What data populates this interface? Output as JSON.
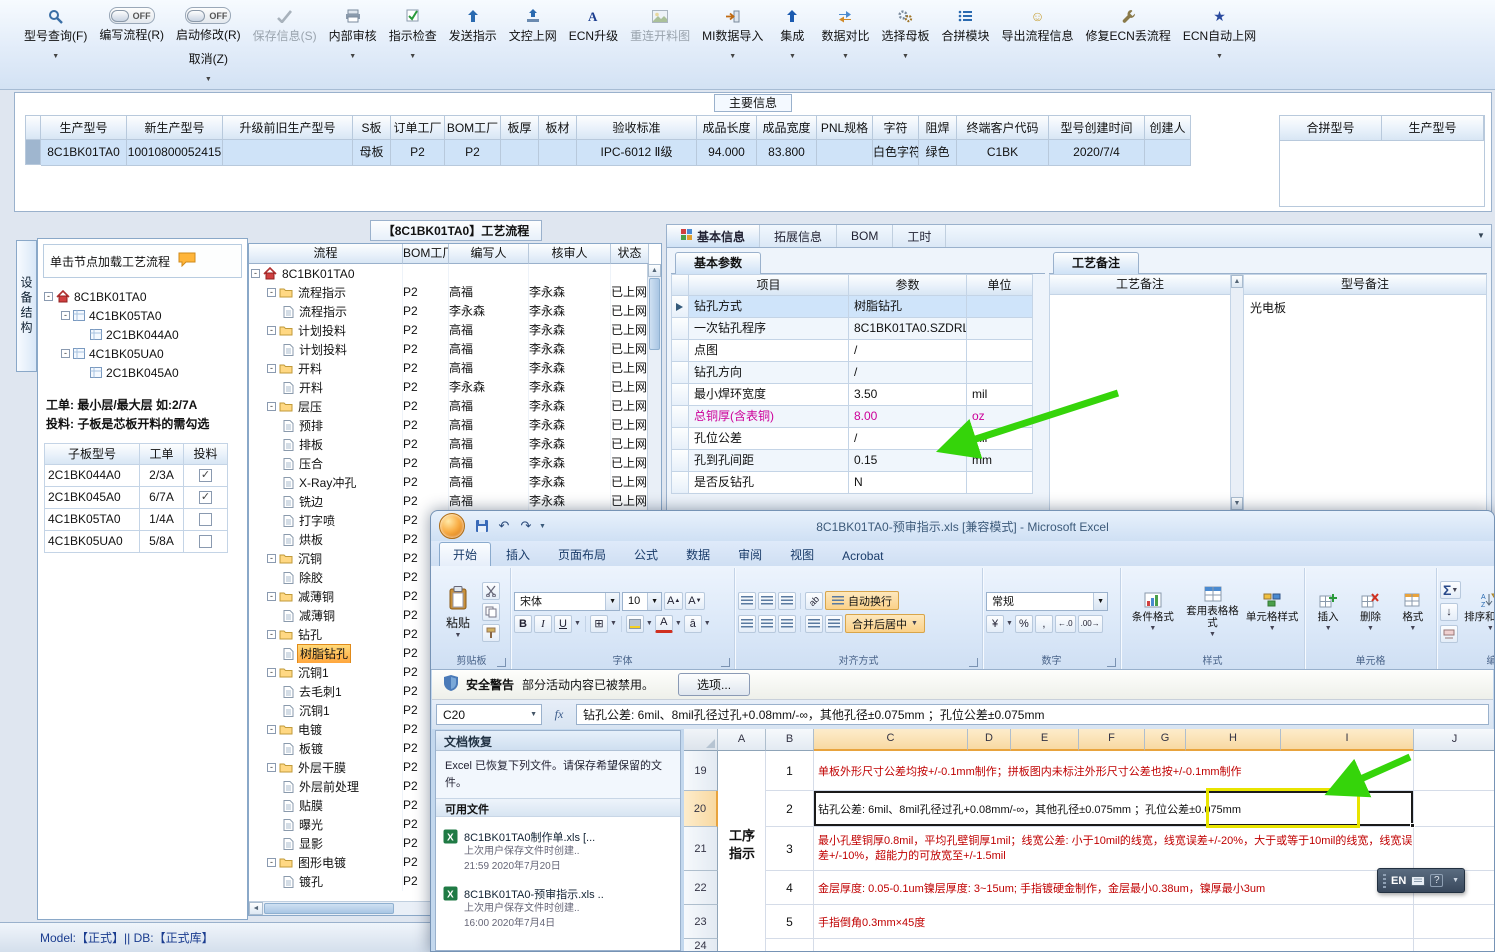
{
  "toolbar": {
    "items": [
      {
        "label": "型号查询(F)",
        "icon": "search",
        "caret": true
      },
      {
        "label": "编写流程(R)",
        "toggle": "OFF"
      },
      {
        "label": "启动修改(R)",
        "toggle": "OFF",
        "sub": "取消(Z)",
        "caret": true
      },
      {
        "label": "保存信息(S)",
        "icon": "save",
        "disabled": true
      },
      {
        "label": "内部审核",
        "icon": "printer",
        "caret": true
      },
      {
        "label": "指示检查",
        "icon": "checkbox",
        "caret": true
      },
      {
        "label": "发送指示",
        "icon": "send"
      },
      {
        "label": "文控上网",
        "icon": "upload"
      },
      {
        "label": "ECN升级",
        "icon": "font"
      },
      {
        "label": "重连开料图",
        "icon": "image",
        "disabled": true
      },
      {
        "label": "MI数据导入",
        "icon": "import",
        "caret": true
      },
      {
        "label": "集成",
        "icon": "integrate",
        "caret": true
      },
      {
        "label": "数据对比",
        "icon": "compare",
        "caret": true
      },
      {
        "label": "选择母板",
        "icon": "gears",
        "caret": true
      },
      {
        "label": "合拼模块",
        "icon": "list"
      },
      {
        "label": "导出流程信息",
        "icon": "smiley"
      },
      {
        "label": "修复ECN丢流程",
        "icon": "wrench"
      },
      {
        "label": "ECN自动上网",
        "icon": "star",
        "caret": true
      }
    ]
  },
  "main_info": {
    "title": "主要信息",
    "columns": [
      "生产型号",
      "新生产型号",
      "升级前旧生产型号",
      "S板",
      "订单工厂",
      "BOM工厂",
      "板厚",
      "板材",
      "验收标准",
      "成品长度",
      "成品宽度",
      "PNL规格",
      "字符",
      "阻焊",
      "终端客户代码",
      "型号创建时间",
      "创建人"
    ],
    "row": [
      "8C1BK01TA0",
      "10010800052415",
      "",
      "母板",
      "P2",
      "P2",
      "",
      "",
      "IPC-6012 Ⅱ级",
      "94.000",
      "83.800",
      "",
      "白色字符",
      "绿色",
      "C1BK",
      "2020/7/4",
      ""
    ],
    "right_columns": [
      "合拼型号",
      "生产型号"
    ]
  },
  "left_panel": {
    "vertical_tab": "设备结构",
    "hint": "单击节点加载工艺流程",
    "tree": [
      {
        "label": "8C1BK01TA0",
        "level": 0,
        "icon": "home",
        "expander": true
      },
      {
        "label": "4C1BK05TA0",
        "level": 1,
        "icon": "board",
        "expander": true
      },
      {
        "label": "2C1BK044A0",
        "level": 2,
        "icon": "board",
        "expander": false
      },
      {
        "label": "4C1BK05UA0",
        "level": 1,
        "icon": "board",
        "expander": true
      },
      {
        "label": "2C1BK045A0",
        "level": 2,
        "icon": "board",
        "expander": false
      }
    ],
    "note_line1": "工单: 最小层/最大层 如:2/7A",
    "note_line2": "投料: 子板是芯板开料的需勾选",
    "board_table": {
      "columns": [
        "子板型号",
        "工单",
        "投料"
      ],
      "rows": [
        {
          "model": "2C1BK044A0",
          "order": "2/3A",
          "checked": true
        },
        {
          "model": "2C1BK045A0",
          "order": "6/7A",
          "checked": true
        },
        {
          "model": "4C1BK05TA0",
          "order": "1/4A",
          "checked": false
        },
        {
          "model": "4C1BK05UA0",
          "order": "5/8A",
          "checked": false
        }
      ]
    }
  },
  "process_panel": {
    "title": "【8C1BK01TA0】工艺流程",
    "columns": [
      "流程",
      "BOM工厂",
      "编写人",
      "核审人",
      "状态"
    ],
    "rows": [
      {
        "name": "8C1BK01TA0",
        "level": 0,
        "icon": "home"
      },
      {
        "name": "流程指示",
        "level": 1,
        "icon": "folder",
        "bom": "P2",
        "writer": "高福",
        "auditor": "李永森",
        "status": "已上网"
      },
      {
        "name": "流程指示",
        "level": 2,
        "icon": "doc",
        "bom": "P2",
        "writer": "李永森",
        "auditor": "李永森",
        "status": "已上网"
      },
      {
        "name": "计划投料",
        "level": 1,
        "icon": "folder",
        "bom": "P2",
        "writer": "高福",
        "auditor": "李永森",
        "status": "已上网"
      },
      {
        "name": "计划投料",
        "level": 2,
        "icon": "doc",
        "bom": "P2",
        "writer": "高福",
        "auditor": "李永森",
        "status": "已上网"
      },
      {
        "name": "开料",
        "level": 1,
        "icon": "folder",
        "bom": "P2",
        "writer": "高福",
        "auditor": "李永森",
        "status": "已上网"
      },
      {
        "name": "开料",
        "level": 2,
        "icon": "doc",
        "bom": "P2",
        "writer": "李永森",
        "auditor": "李永森",
        "status": "已上网"
      },
      {
        "name": "层压",
        "level": 1,
        "icon": "folder",
        "bom": "P2",
        "writer": "高福",
        "auditor": "李永森",
        "status": "已上网"
      },
      {
        "name": "预排",
        "level": 2,
        "icon": "doc",
        "bom": "P2",
        "writer": "高福",
        "auditor": "李永森",
        "status": "已上网"
      },
      {
        "name": "排板",
        "level": 2,
        "icon": "doc",
        "bom": "P2",
        "writer": "高福",
        "auditor": "李永森",
        "status": "已上网"
      },
      {
        "name": "压合",
        "level": 2,
        "icon": "doc",
        "bom": "P2",
        "writer": "高福",
        "auditor": "李永森",
        "status": "已上网"
      },
      {
        "name": "X-Ray冲孔",
        "level": 2,
        "icon": "doc",
        "bom": "P2",
        "writer": "高福",
        "auditor": "李永森",
        "status": "已上网"
      },
      {
        "name": "铣边",
        "level": 2,
        "icon": "doc",
        "bom": "P2",
        "writer": "高福",
        "auditor": "李永森",
        "status": "已上网"
      },
      {
        "name": "打字喷",
        "level": 2,
        "icon": "doc",
        "bom": "P2"
      },
      {
        "name": "烘板",
        "level": 2,
        "icon": "doc",
        "bom": "P2"
      },
      {
        "name": "沉铜",
        "level": 1,
        "icon": "folder",
        "bom": "P2"
      },
      {
        "name": "除胶",
        "level": 2,
        "icon": "doc",
        "bom": "P2"
      },
      {
        "name": "减薄铜",
        "level": 1,
        "icon": "folder",
        "bom": "P2"
      },
      {
        "name": "减薄铜",
        "level": 2,
        "icon": "doc",
        "bom": "P2"
      },
      {
        "name": "钻孔",
        "level": 1,
        "icon": "folder",
        "bom": "P2"
      },
      {
        "name": "树脂钻孔",
        "level": 2,
        "icon": "doc",
        "bom": "P2",
        "selected": true
      },
      {
        "name": "沉铜1",
        "level": 1,
        "icon": "folder",
        "bom": "P2"
      },
      {
        "name": "去毛刺1",
        "level": 2,
        "icon": "doc",
        "bom": "P2"
      },
      {
        "name": "沉铜1",
        "level": 2,
        "icon": "doc",
        "bom": "P2"
      },
      {
        "name": "电镀",
        "level": 1,
        "icon": "folder",
        "bom": "P2"
      },
      {
        "name": "板镀",
        "level": 2,
        "icon": "doc",
        "bom": "P2"
      },
      {
        "name": "外层干膜",
        "level": 1,
        "icon": "folder",
        "bom": "P2"
      },
      {
        "name": "外层前处理",
        "level": 2,
        "icon": "doc",
        "bom": "P2"
      },
      {
        "name": "贴膜",
        "level": 2,
        "icon": "doc",
        "bom": "P2"
      },
      {
        "name": "曝光",
        "level": 2,
        "icon": "doc",
        "bom": "P2"
      },
      {
        "name": "显影",
        "level": 2,
        "icon": "doc",
        "bom": "P2"
      },
      {
        "name": "图形电镀",
        "level": 1,
        "icon": "folder",
        "bom": "P2"
      },
      {
        "name": "镀孔",
        "level": 2,
        "icon": "doc",
        "bom": "P2"
      }
    ]
  },
  "detail_panel": {
    "tabs": [
      "基本信息",
      "拓展信息",
      "BOM",
      "工时"
    ],
    "active_tab": "基本信息",
    "params_title": "基本参数",
    "params_columns": [
      "项目",
      "参数",
      "单位"
    ],
    "params_rows": [
      {
        "item": "钻孔方式",
        "value": "树脂钻孔",
        "unit": "",
        "selected": true
      },
      {
        "item": "一次钻孔程序",
        "value": "8C1BK01TA0.SZDRL",
        "unit": ""
      },
      {
        "item": "点图",
        "value": "/",
        "unit": ""
      },
      {
        "item": "钻孔方向",
        "value": "/",
        "unit": ""
      },
      {
        "item": "最小焊环宽度",
        "value": "3.50",
        "unit": "mil"
      },
      {
        "item": "总铜厚(含表铜)",
        "value": "8.00",
        "unit": "oz",
        "highlight": true
      },
      {
        "item": "孔位公差",
        "value": "/",
        "unit": "mil"
      },
      {
        "item": "孔到孔间距",
        "value": "0.15",
        "unit": "mm"
      },
      {
        "item": "是否反钻孔",
        "value": "N",
        "unit": ""
      }
    ],
    "remarks_title": "工艺备注",
    "remarks_columns": [
      "工艺备注",
      "型号备注"
    ],
    "model_remark": "光电板"
  },
  "excel": {
    "title": "8C1BK01TA0-预审指示.xls [兼容模式] - Microsoft Excel",
    "ribbon_tabs": [
      "开始",
      "插入",
      "页面布局",
      "公式",
      "数据",
      "审阅",
      "视图",
      "Acrobat"
    ],
    "active_ribbon_tab": "开始",
    "font_name": "宋体",
    "font_size": "10",
    "ribbon": {
      "paste_label": "粘贴",
      "clipboard_label": "剪贴板",
      "font_label": "字体",
      "align_label": "对齐方式",
      "wrap_label": "自动换行",
      "merge_label": "合并后居中",
      "number_label": "数字",
      "number_format": "常规",
      "styles_label": "样式",
      "cond_format": "条件格式",
      "table_format": "套用表格格式",
      "cell_styles": "单元格样式",
      "cells_label": "单元格",
      "insert_label": "插入",
      "delete_label": "删除",
      "format_label": "格式",
      "editing_label": "编辑",
      "sort_label": "排序和筛选"
    },
    "security": {
      "label": "安全警告",
      "message": "部分活动内容已被禁用。",
      "button": "选项..."
    },
    "name_box": "C20",
    "formula": "钻孔公差: 6mil、8mil孔径过孔+0.08mm/-∞，其他孔径±0.075mm ；孔位公差±0.075mm",
    "recovery": {
      "title": "文档恢复",
      "message": "Excel 已恢复下列文件。请保存希望保留的文件。",
      "section": "可用文件",
      "files": [
        {
          "name": "8C1BK01TA0制作单.xls [...",
          "desc": "上次用户保存文件时创建..",
          "time": "21:59 2020年7月20日"
        },
        {
          "name": "8C1BK01TA0-预审指示.xls ..",
          "desc": "上次用户保存文件时创建..",
          "time": "16:00 2020年7月4日"
        }
      ]
    },
    "sheet": {
      "columns": [
        "A",
        "B",
        "C",
        "D",
        "E",
        "F",
        "G",
        "H",
        "I",
        "J"
      ],
      "selected_columns": [
        "C",
        "D",
        "E",
        "F",
        "G",
        "H",
        "I"
      ],
      "section_label": "工序指示",
      "rows": [
        {
          "rownum": "19",
          "num": "1",
          "text": "单板外形尺寸公差均按+/-0.1mm制作；拼板图内未标注外形尺寸公差也按+/-0.1mm制作",
          "color": "red"
        },
        {
          "rownum": "20",
          "num": "2",
          "text": "钻孔公差: 6mil、8mil孔径过孔+0.08mm/-∞，其他孔径±0.075mm ；孔位公差±0.075mm",
          "color": "black",
          "selected": true
        },
        {
          "rownum": "21",
          "num": "3",
          "text": "最小孔壁铜厚0.8mil，平均孔壁铜厚1mil；线宽公差: 小于10mil的线宽，线宽误差+/-20%，大于或等于10mil的线宽，线宽误差+/-10%，超能力的可放宽至+/-1.5mil",
          "color": "red",
          "wrap": true
        },
        {
          "rownum": "22",
          "num": "4",
          "text": "金层厚度: 0.05-0.1um镍层厚度: 3~15um; 手指镀硬金制作，金层最小0.38um，镍厚最小3um",
          "color": "red"
        },
        {
          "rownum": "23",
          "num": "5",
          "text": "手指倒角0.3mm×45度",
          "color": "red"
        },
        {
          "rownum": "24",
          "num": "",
          "text": "",
          "color": "black"
        }
      ]
    }
  },
  "lang_bar": {
    "label": "EN"
  },
  "status_bar": "Model:【正式】|| DB:【正式库】",
  "annotations": {
    "arrow_color": "#35d40a",
    "highlight_box_color": "#e8e400",
    "highlighted_text": "孔位公差±0.075mm"
  },
  "colors": {
    "selection_blue": "#cfe3f8",
    "process_highlight_orange": "#ffb94a",
    "param_magenta": "#cc0099",
    "excel_red_text": "#c00000"
  }
}
